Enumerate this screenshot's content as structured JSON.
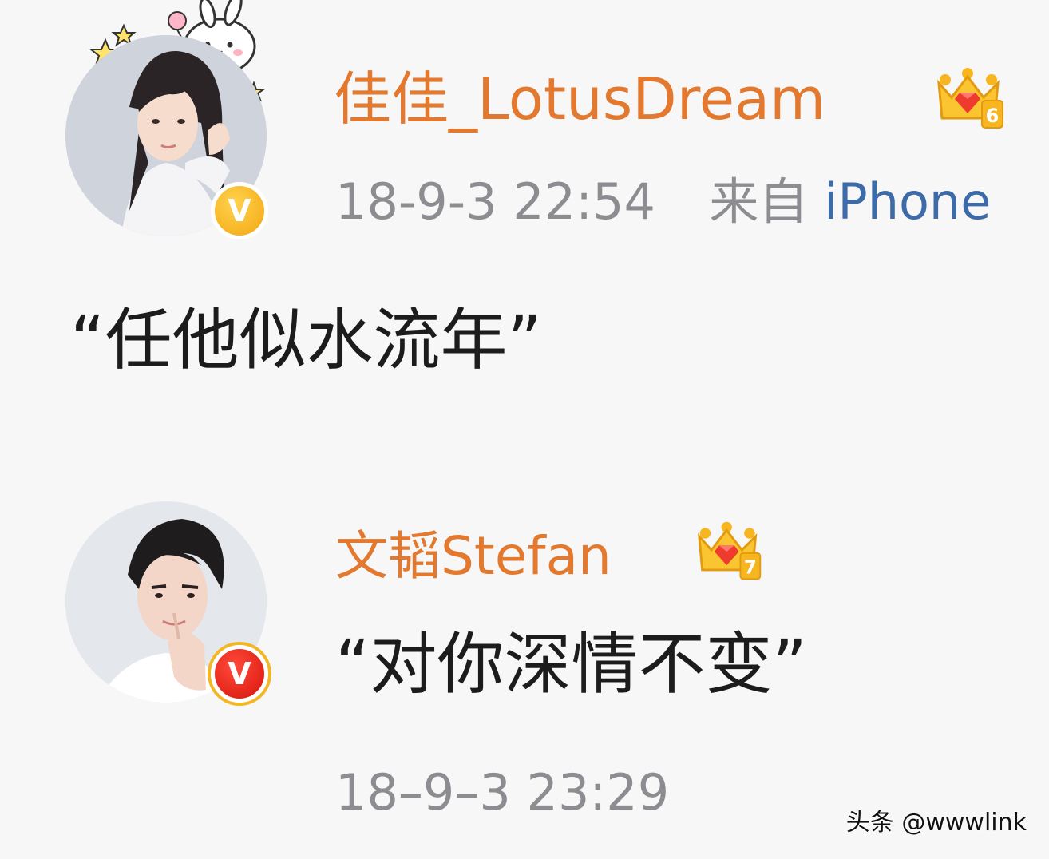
{
  "comments": [
    {
      "username": "佳佳_LotusDream",
      "crown_level": "6",
      "timestamp": "18-9-3 22:54",
      "source_prefix": "来自",
      "source_device": "iPhone",
      "text": "“任他似水流年”",
      "verify_badge": "V",
      "verify_color": "#f3a712",
      "avatar_icon": "female-portrait-avatar"
    },
    {
      "username": "文韬Stefan",
      "crown_level": "7",
      "timestamp": "18–9–3 23:29",
      "text": "“对你深情不变”",
      "verify_badge": "V",
      "verify_color": "#d7140c",
      "avatar_icon": "male-portrait-avatar"
    }
  ],
  "colors": {
    "username": "#e3792f",
    "meta": "#8d8d91",
    "source_link": "#3d6aa8",
    "content": "#1c1c1c",
    "background": "#f7f7f8"
  },
  "watermark": "头条 @wwwlink"
}
